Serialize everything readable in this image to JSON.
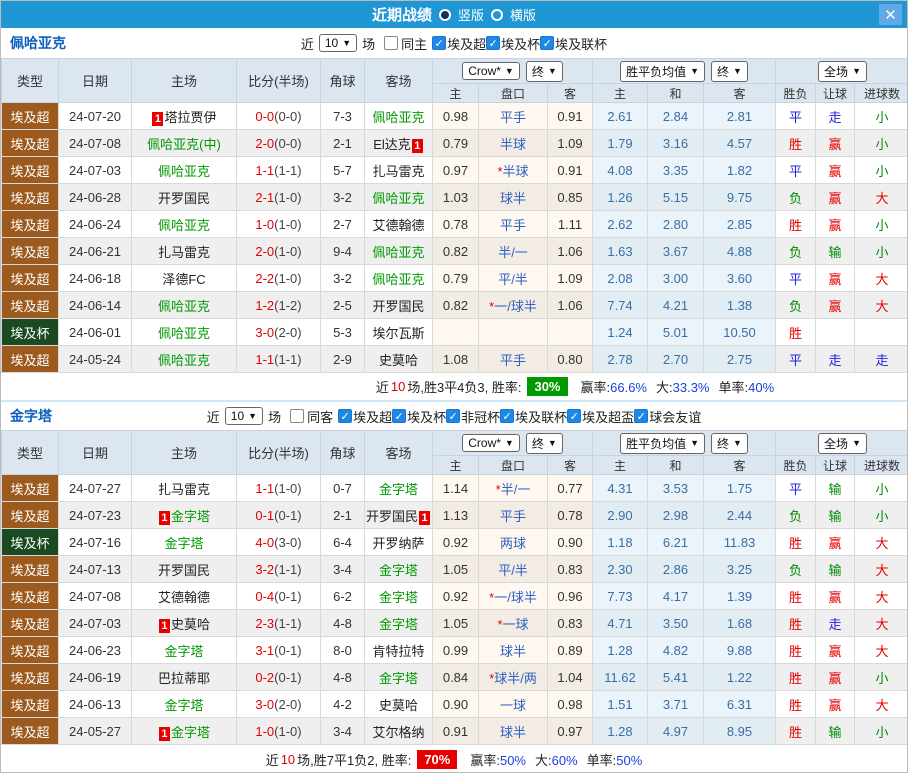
{
  "titlebar": {
    "title": "近期战绩",
    "radios": [
      {
        "label": "竖版",
        "selected": true
      },
      {
        "label": "横版",
        "selected": false
      }
    ],
    "close": "✕"
  },
  "table_header": {
    "cols": [
      "类型",
      "日期",
      "主场",
      "比分(半场)",
      "角球",
      "客场"
    ],
    "crow": {
      "sel": "Crow*",
      "fin": "终",
      "subs": [
        "主",
        "盘口",
        "客"
      ]
    },
    "wdl": {
      "sel": "胜平负均值",
      "fin": "终",
      "subs": [
        "主",
        "和",
        "客"
      ]
    },
    "result": {
      "sel": "全场",
      "subs": [
        "胜负",
        "让球",
        "进球数"
      ]
    }
  },
  "colors": {
    "topbar": "#1E97D4",
    "league": {
      "埃及超": "#9C5A1E",
      "埃及杯": "#1C4A20"
    },
    "result": {
      "胜": "#E60000",
      "平": "#2222DD",
      "负": "#008800",
      "赢": "#E60000",
      "输": "#008800",
      "走": "#2222DD",
      "大": "#E60000",
      "小": "#008800"
    },
    "team_green": "#009900",
    "team_black": "#222222"
  },
  "sections": [
    {
      "team": "佩哈亚克",
      "filter": {
        "near": "近",
        "count": "10",
        "field": "场",
        "same": "同主",
        "same_checked": false,
        "leagues": [
          {
            "label": "埃及超",
            "checked": true
          },
          {
            "label": "埃及杯",
            "checked": true
          },
          {
            "label": "埃及联杯",
            "checked": true
          }
        ]
      },
      "rows": [
        {
          "league": "埃及超",
          "date": "24-07-20",
          "home": {
            "name": "塔拉贾伊",
            "green": false,
            "badge": "1",
            "badge_pos": "before"
          },
          "score": "0-0",
          "half": "(0-0)",
          "corner": "7-3",
          "away": {
            "name": "佩哈亚克",
            "green": true
          },
          "odds": [
            "0.98",
            "平手",
            "0.91"
          ],
          "wdl": [
            "2.61",
            "2.84",
            "2.81"
          ],
          "results": [
            "平",
            "走",
            "小"
          ]
        },
        {
          "league": "埃及超",
          "date": "24-07-08",
          "home": {
            "name": "佩哈亚克(中)",
            "green": true
          },
          "score": "2-0",
          "half": "(0-0)",
          "corner": "2-1",
          "away": {
            "name": "El达克",
            "green": false,
            "badge": "1",
            "badge_pos": "after"
          },
          "odds": [
            "0.79",
            "半球",
            "1.09"
          ],
          "wdl": [
            "1.79",
            "3.16",
            "4.57"
          ],
          "results": [
            "胜",
            "赢",
            "小"
          ]
        },
        {
          "league": "埃及超",
          "date": "24-07-03",
          "home": {
            "name": "佩哈亚克",
            "green": true
          },
          "score": "1-1",
          "half": "(1-1)",
          "corner": "5-7",
          "away": {
            "name": "扎马雷克",
            "green": false
          },
          "odds": [
            "0.97",
            "*半球",
            "0.91"
          ],
          "wdl": [
            "4.08",
            "3.35",
            "1.82"
          ],
          "results": [
            "平",
            "赢",
            "小"
          ]
        },
        {
          "league": "埃及超",
          "date": "24-06-28",
          "home": {
            "name": "开罗国民",
            "green": false
          },
          "score": "2-1",
          "half": "(1-0)",
          "corner": "3-2",
          "away": {
            "name": "佩哈亚克",
            "green": true
          },
          "odds": [
            "1.03",
            "球半",
            "0.85"
          ],
          "wdl": [
            "1.26",
            "5.15",
            "9.75"
          ],
          "results": [
            "负",
            "赢",
            "大"
          ]
        },
        {
          "league": "埃及超",
          "date": "24-06-24",
          "home": {
            "name": "佩哈亚克",
            "green": true
          },
          "score": "1-0",
          "half": "(1-0)",
          "corner": "2-7",
          "away": {
            "name": "艾德翰德",
            "green": false
          },
          "odds": [
            "0.78",
            "平手",
            "1.11"
          ],
          "wdl": [
            "2.62",
            "2.80",
            "2.85"
          ],
          "results": [
            "胜",
            "赢",
            "小"
          ]
        },
        {
          "league": "埃及超",
          "date": "24-06-21",
          "home": {
            "name": "扎马雷克",
            "green": false
          },
          "score": "2-0",
          "half": "(1-0)",
          "corner": "9-4",
          "away": {
            "name": "佩哈亚克",
            "green": true
          },
          "odds": [
            "0.82",
            "半/一",
            "1.06"
          ],
          "wdl": [
            "1.63",
            "3.67",
            "4.88"
          ],
          "results": [
            "负",
            "输",
            "小"
          ]
        },
        {
          "league": "埃及超",
          "date": "24-06-18",
          "home": {
            "name": "泽德FC",
            "green": false
          },
          "score": "2-2",
          "half": "(1-0)",
          "corner": "3-2",
          "away": {
            "name": "佩哈亚克",
            "green": true
          },
          "odds": [
            "0.79",
            "平/半",
            "1.09"
          ],
          "wdl": [
            "2.08",
            "3.00",
            "3.60"
          ],
          "results": [
            "平",
            "赢",
            "大"
          ]
        },
        {
          "league": "埃及超",
          "date": "24-06-14",
          "home": {
            "name": "佩哈亚克",
            "green": true
          },
          "score": "1-2",
          "half": "(1-2)",
          "corner": "2-5",
          "away": {
            "name": "开罗国民",
            "green": false
          },
          "odds": [
            "0.82",
            "*一/球半",
            "1.06"
          ],
          "wdl": [
            "7.74",
            "4.21",
            "1.38"
          ],
          "results": [
            "负",
            "赢",
            "大"
          ]
        },
        {
          "league": "埃及杯",
          "date": "24-06-01",
          "home": {
            "name": "佩哈亚克",
            "green": true
          },
          "score": "3-0",
          "half": "(2-0)",
          "corner": "5-3",
          "away": {
            "name": "埃尔瓦斯",
            "green": false
          },
          "odds": [
            "",
            "",
            ""
          ],
          "wdl": [
            "1.24",
            "5.01",
            "10.50"
          ],
          "results": [
            "胜",
            "",
            ""
          ]
        },
        {
          "league": "埃及超",
          "date": "24-05-24",
          "home": {
            "name": "佩哈亚克",
            "green": true
          },
          "score": "1-1",
          "half": "(1-1)",
          "corner": "2-9",
          "away": {
            "name": "史莫哈",
            "green": false
          },
          "odds": [
            "1.08",
            "平手",
            "0.80"
          ],
          "wdl": [
            "2.78",
            "2.70",
            "2.75"
          ],
          "results": [
            "平",
            "走",
            "走"
          ]
        }
      ],
      "summary": {
        "near": "近",
        "count": "10",
        "record": "场,胜3平4负3, 胜率:",
        "rate": "30%",
        "rate_bg": "#009900",
        "stats": [
          {
            "label": "赢率:",
            "value": "66.6%"
          },
          {
            "label": "大:",
            "value": "33.3%"
          },
          {
            "label": "单率:",
            "value": "40%"
          }
        ]
      }
    },
    {
      "team": "金字塔",
      "filter": {
        "near": "近",
        "count": "10",
        "field": "场",
        "same": "同客",
        "same_checked": false,
        "leagues": [
          {
            "label": "埃及超",
            "checked": true
          },
          {
            "label": "埃及杯",
            "checked": true
          },
          {
            "label": "非冠杯",
            "checked": true
          },
          {
            "label": "埃及联杯",
            "checked": true
          },
          {
            "label": "埃及超盃",
            "checked": true
          },
          {
            "label": "球会友谊",
            "checked": true
          }
        ]
      },
      "rows": [
        {
          "league": "埃及超",
          "date": "24-07-27",
          "home": {
            "name": "扎马雷克",
            "green": false
          },
          "score": "1-1",
          "half": "(1-0)",
          "corner": "0-7",
          "away": {
            "name": "金字塔",
            "green": true
          },
          "odds": [
            "1.14",
            "*半/一",
            "0.77"
          ],
          "wdl": [
            "4.31",
            "3.53",
            "1.75"
          ],
          "results": [
            "平",
            "输",
            "小"
          ]
        },
        {
          "league": "埃及超",
          "date": "24-07-23",
          "home": {
            "name": "金字塔",
            "green": true,
            "badge": "1",
            "badge_pos": "before"
          },
          "score": "0-1",
          "half": "(0-1)",
          "corner": "2-1",
          "away": {
            "name": "开罗国民",
            "green": false,
            "badge": "1",
            "badge_pos": "after"
          },
          "odds": [
            "1.13",
            "平手",
            "0.78"
          ],
          "wdl": [
            "2.90",
            "2.98",
            "2.44"
          ],
          "results": [
            "负",
            "输",
            "小"
          ]
        },
        {
          "league": "埃及杯",
          "date": "24-07-16",
          "home": {
            "name": "金字塔",
            "green": true
          },
          "score": "4-0",
          "half": "(3-0)",
          "corner": "6-4",
          "away": {
            "name": "开罗纳萨",
            "green": false
          },
          "odds": [
            "0.92",
            "两球",
            "0.90"
          ],
          "wdl": [
            "1.18",
            "6.21",
            "11.83"
          ],
          "results": [
            "胜",
            "赢",
            "大"
          ]
        },
        {
          "league": "埃及超",
          "date": "24-07-13",
          "home": {
            "name": "开罗国民",
            "green": false
          },
          "score": "3-2",
          "half": "(1-1)",
          "corner": "3-4",
          "away": {
            "name": "金字塔",
            "green": true
          },
          "odds": [
            "1.05",
            "平/半",
            "0.83"
          ],
          "wdl": [
            "2.30",
            "2.86",
            "3.25"
          ],
          "results": [
            "负",
            "输",
            "大"
          ]
        },
        {
          "league": "埃及超",
          "date": "24-07-08",
          "home": {
            "name": "艾德翰德",
            "green": false
          },
          "score": "0-4",
          "half": "(0-1)",
          "corner": "6-2",
          "away": {
            "name": "金字塔",
            "green": true
          },
          "odds": [
            "0.92",
            "*一/球半",
            "0.96"
          ],
          "wdl": [
            "7.73",
            "4.17",
            "1.39"
          ],
          "results": [
            "胜",
            "赢",
            "大"
          ]
        },
        {
          "league": "埃及超",
          "date": "24-07-03",
          "home": {
            "name": "史莫哈",
            "green": false,
            "badge": "1",
            "badge_pos": "before"
          },
          "score": "2-3",
          "half": "(1-1)",
          "corner": "4-8",
          "away": {
            "name": "金字塔",
            "green": true
          },
          "odds": [
            "1.05",
            "*一球",
            "0.83"
          ],
          "wdl": [
            "4.71",
            "3.50",
            "1.68"
          ],
          "results": [
            "胜",
            "走",
            "大"
          ]
        },
        {
          "league": "埃及超",
          "date": "24-06-23",
          "home": {
            "name": "金字塔",
            "green": true
          },
          "score": "3-1",
          "half": "(0-1)",
          "corner": "8-0",
          "away": {
            "name": "肯特拉特",
            "green": false
          },
          "odds": [
            "0.99",
            "球半",
            "0.89"
          ],
          "wdl": [
            "1.28",
            "4.82",
            "9.88"
          ],
          "results": [
            "胜",
            "赢",
            "大"
          ]
        },
        {
          "league": "埃及超",
          "date": "24-06-19",
          "home": {
            "name": "巴拉蒂耶",
            "green": false
          },
          "score": "0-2",
          "half": "(0-1)",
          "corner": "4-8",
          "away": {
            "name": "金字塔",
            "green": true
          },
          "odds": [
            "0.84",
            "*球半/两",
            "1.04"
          ],
          "wdl": [
            "11.62",
            "5.41",
            "1.22"
          ],
          "results": [
            "胜",
            "赢",
            "小"
          ]
        },
        {
          "league": "埃及超",
          "date": "24-06-13",
          "home": {
            "name": "金字塔",
            "green": true
          },
          "score": "3-0",
          "half": "(2-0)",
          "corner": "4-2",
          "away": {
            "name": "史莫哈",
            "green": false
          },
          "odds": [
            "0.90",
            "一球",
            "0.98"
          ],
          "wdl": [
            "1.51",
            "3.71",
            "6.31"
          ],
          "results": [
            "胜",
            "赢",
            "大"
          ]
        },
        {
          "league": "埃及超",
          "date": "24-05-27",
          "home": {
            "name": "金字塔",
            "green": true,
            "badge": "1",
            "badge_pos": "before"
          },
          "score": "1-0",
          "half": "(1-0)",
          "corner": "3-4",
          "away": {
            "name": "艾尔格纳",
            "green": false
          },
          "odds": [
            "0.91",
            "球半",
            "0.97"
          ],
          "wdl": [
            "1.28",
            "4.97",
            "8.95"
          ],
          "results": [
            "胜",
            "输",
            "小"
          ]
        }
      ],
      "summary": {
        "near": "近",
        "count": "10",
        "record": "场,胜7平1负2, 胜率:",
        "rate": "70%",
        "rate_bg": "#E60000",
        "stats": [
          {
            "label": "赢率:",
            "value": "50%"
          },
          {
            "label": "大:",
            "value": "60%"
          },
          {
            "label": "单率:",
            "value": "50%"
          }
        ]
      }
    }
  ]
}
